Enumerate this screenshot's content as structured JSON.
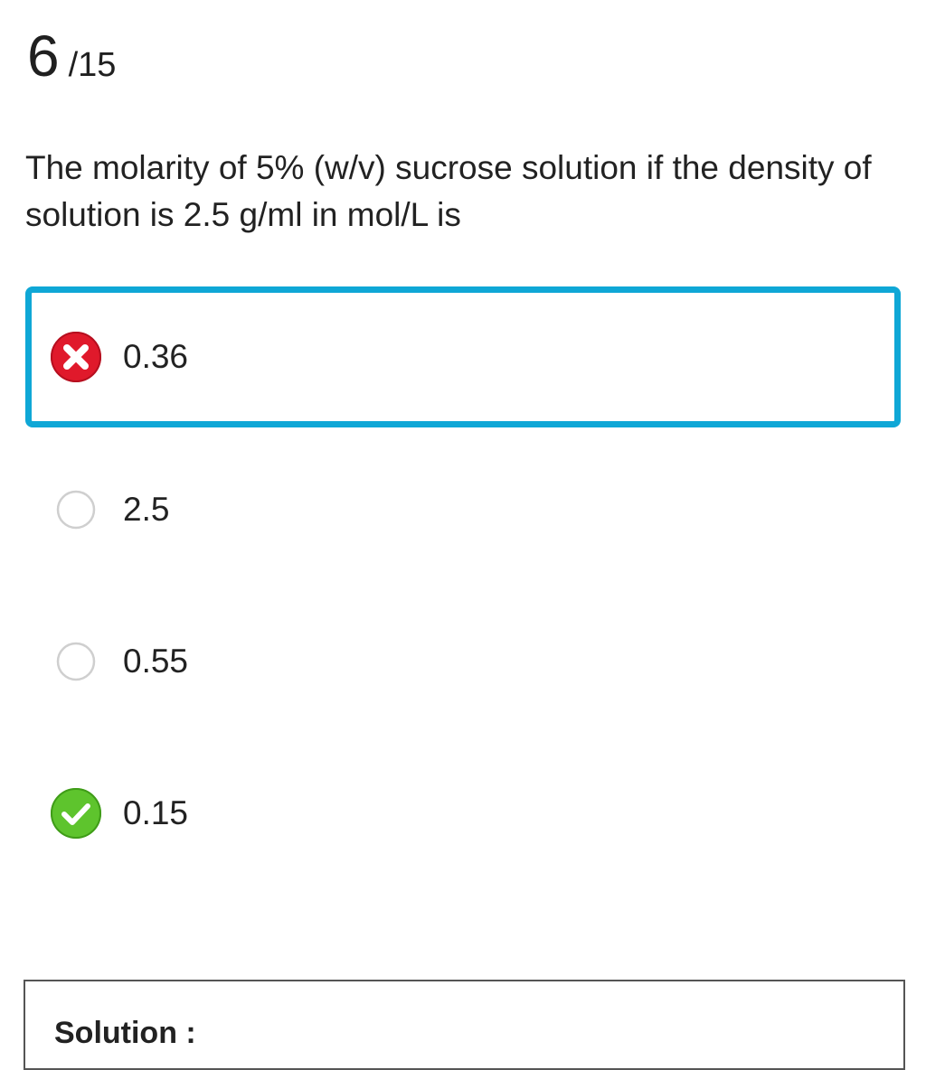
{
  "question": {
    "number": "6",
    "total": "/15",
    "text": "The molarity of 5% (w/v) sucrose solution if the density of solution is 2.5 g/ml in mol/L is"
  },
  "options": [
    {
      "label": "0.36",
      "state": "selected-wrong",
      "icon": "wrong-x-icon"
    },
    {
      "label": "2.5",
      "state": "unselected",
      "icon": "radio-icon"
    },
    {
      "label": "0.55",
      "state": "unselected",
      "icon": "radio-icon"
    },
    {
      "label": "0.15",
      "state": "correct",
      "icon": "correct-check-icon"
    }
  ],
  "solution": {
    "title": "Solution :"
  },
  "colors": {
    "selected_border": "#0fa7d6",
    "wrong": "#e0192b",
    "correct": "#5ec42d",
    "radio_border": "#cfcfcf"
  }
}
